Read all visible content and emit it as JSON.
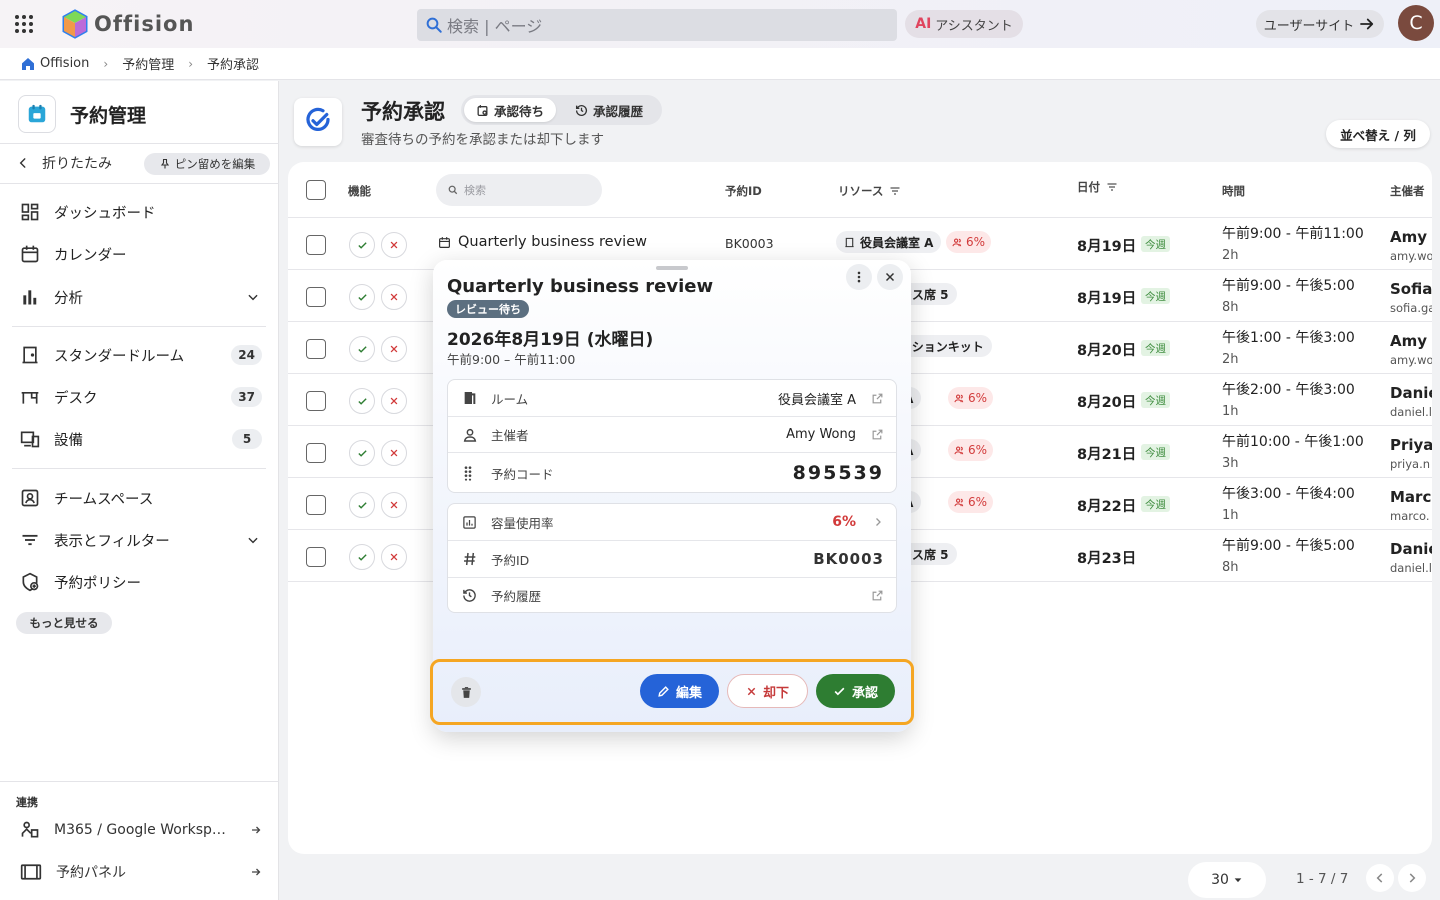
{
  "header": {
    "logo_text": "Offision",
    "search_placeholder": "検索 | ページ",
    "ai_mark": "AI",
    "ai_label": "アシスタント",
    "user_site_label": "ユーザーサイト",
    "avatar_initial": "C"
  },
  "breadcrumb": [
    "Offision",
    "予約管理",
    "予約承認"
  ],
  "sidebar": {
    "title": "予約管理",
    "collapse_label": "折りたたみ",
    "pin_edit_label": "ピン留めを編集",
    "items": [
      {
        "label": "ダッシュボード",
        "icon": "dashboard-icon"
      },
      {
        "label": "カレンダー",
        "icon": "calendar-icon"
      },
      {
        "label": "分析",
        "icon": "analytics-icon",
        "expandable": true
      },
      {
        "label": "スタンダードルーム",
        "icon": "room-icon",
        "count": "24"
      },
      {
        "label": "デスク",
        "icon": "desk-icon",
        "count": "37"
      },
      {
        "label": "設備",
        "icon": "equipment-icon",
        "count": "5"
      },
      {
        "label": "チームスペース",
        "icon": "team-space-icon"
      },
      {
        "label": "表示とフィルター",
        "icon": "filter-icon",
        "expandable": true
      },
      {
        "label": "予約ポリシー",
        "icon": "policy-icon"
      }
    ],
    "more_label": "もっと見せる",
    "integrations_label": "連携",
    "integrations": [
      {
        "label": "M365 / Google Worksp…",
        "icon": "integration-icon"
      },
      {
        "label": "予約パネル",
        "icon": "panel-icon"
      }
    ]
  },
  "page": {
    "title": "予約承認",
    "subtitle": "審査待ちの予約を承認または却下します",
    "tabs": [
      {
        "label": "承認待ち",
        "active": true
      },
      {
        "label": "承認履歴",
        "active": false
      }
    ],
    "sort_label": "並べ替え / 列"
  },
  "table": {
    "headers": {
      "actions": "機能",
      "search_placeholder": "検索",
      "id": "予約ID",
      "resource": "リソース",
      "date": "日付",
      "time": "時間",
      "host": "主催者"
    },
    "rows": [
      {
        "title": "Quarterly business review",
        "id": "BK0003",
        "resource": "役員会議室 A",
        "capacity": "6%",
        "date": "8月19日",
        "week": "今週",
        "time": "午前9:00 - 午前11:00",
        "duration": "2h",
        "host": "Amy W",
        "email": "amy.wo"
      },
      {
        "title": "",
        "id": "",
        "resource": "ドレス席 5",
        "capacity": "",
        "date": "8月19日",
        "week": "今週",
        "time": "午前9:00 - 午後5:00",
        "duration": "8h",
        "host": "Sofia",
        "email": "sofia.ga"
      },
      {
        "title": "",
        "id": "",
        "resource": "テーションキット",
        "capacity": "",
        "date": "8月20日",
        "week": "今週",
        "time": "午後1:00 - 午後3:00",
        "duration": "2h",
        "host": "Amy W",
        "email": "amy.wo"
      },
      {
        "title": "",
        "id": "",
        "resource": "室 A",
        "capacity": "6%",
        "date": "8月20日",
        "week": "今週",
        "time": "午後2:00 - 午後3:00",
        "duration": "1h",
        "host": "Danie",
        "email": "daniel.l"
      },
      {
        "title": "",
        "id": "",
        "resource": "室 A",
        "capacity": "6%",
        "date": "8月21日",
        "week": "今週",
        "time": "午前10:00 - 午後1:00",
        "duration": "3h",
        "host": "Priya",
        "email": "priya.n"
      },
      {
        "title": "",
        "id": "",
        "resource": "室 A",
        "capacity": "6%",
        "date": "8月22日",
        "week": "今週",
        "time": "午後3:00 - 午後4:00",
        "duration": "1h",
        "host": "Marco",
        "email": "marco."
      },
      {
        "title": "",
        "id": "",
        "resource": "ドレス席 5",
        "capacity": "",
        "date": "8月23日",
        "week": "",
        "time": "午前9:00 - 午後5:00",
        "duration": "8h",
        "host": "Danie",
        "email": "daniel.l"
      }
    ]
  },
  "pagination": {
    "page_size": "30",
    "range": "1 - 7 / 7"
  },
  "modal": {
    "title": "Quarterly business review",
    "status": "レビュー待ち",
    "date": "2026年8月19日 (水曜日)",
    "time": "午前9:00 – 午前11:00",
    "details": [
      {
        "label": "ルーム",
        "value": "役員会議室 A"
      },
      {
        "label": "主催者",
        "value": "Amy Wong"
      },
      {
        "label": "予約コード",
        "value": "895539"
      }
    ],
    "details2": [
      {
        "label": "容量使用率",
        "value": "6%"
      },
      {
        "label": "予約ID",
        "value": "BK0003"
      },
      {
        "label": "予約履歴",
        "value": ""
      }
    ],
    "edit_label": "編集",
    "reject_label": "却下",
    "approve_label": "承認"
  },
  "colors": {
    "accent": "#2563d8",
    "approve": "#2e7d32",
    "reject": "#c53a3a",
    "highlight": "#f5a623",
    "capacity_red": "#d23b3b"
  }
}
